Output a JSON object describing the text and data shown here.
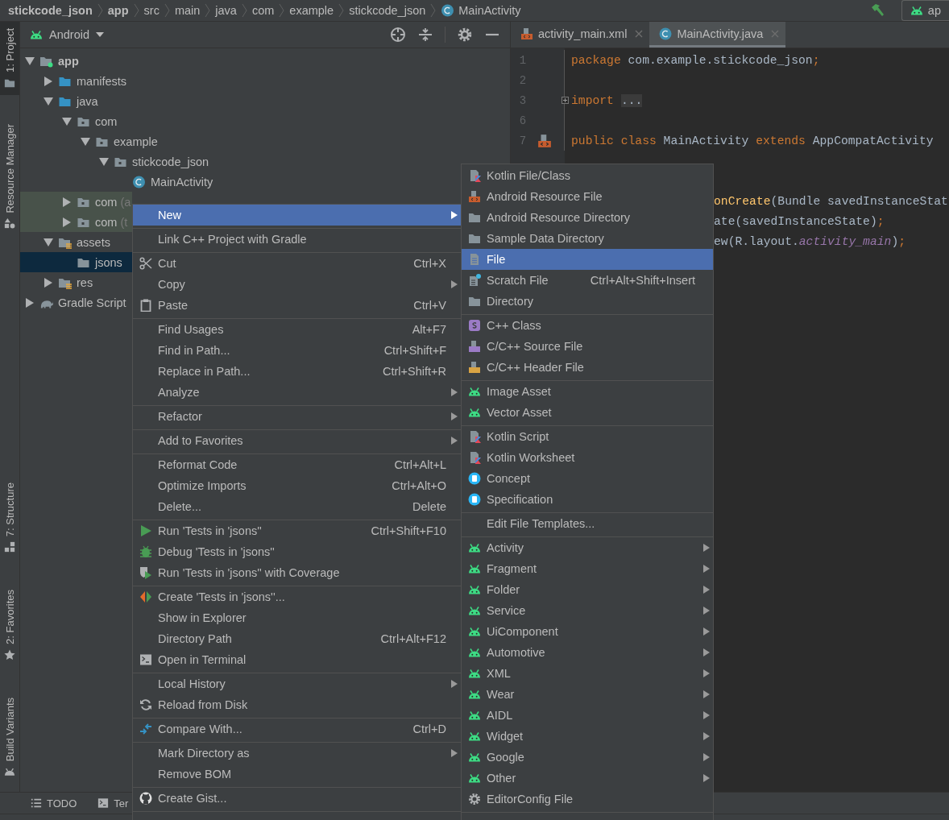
{
  "breadcrumbs": [
    {
      "label": "stickcode_json",
      "bold": true,
      "kind": "path"
    },
    {
      "label": "app",
      "bold": true,
      "kind": "path"
    },
    {
      "label": "src",
      "bold": false,
      "kind": "path"
    },
    {
      "label": "main",
      "bold": false,
      "kind": "path"
    },
    {
      "label": "java",
      "bold": false,
      "kind": "path"
    },
    {
      "label": "com",
      "bold": false,
      "kind": "path"
    },
    {
      "label": "example",
      "bold": false,
      "kind": "path"
    },
    {
      "label": "stickcode_json",
      "bold": false,
      "kind": "path"
    },
    {
      "label": "MainActivity",
      "bold": false,
      "kind": "class"
    }
  ],
  "toolbar": {
    "run_config": "ap"
  },
  "tool_strip": {
    "top": [
      {
        "label": "1: Project",
        "selected": true,
        "kind": "project"
      },
      {
        "label": "Resource Manager",
        "selected": false,
        "kind": "resources"
      }
    ],
    "bottom": [
      {
        "label": "7: Structure",
        "selected": false,
        "kind": "structure"
      },
      {
        "label": "2: Favorites",
        "selected": false,
        "kind": "favorites"
      },
      {
        "label": "Build Variants",
        "selected": false,
        "kind": "build-variants"
      }
    ]
  },
  "project_panel": {
    "view": "Android",
    "tree": [
      {
        "label": "app",
        "kind": "module",
        "bold": true,
        "test": false,
        "selected": false,
        "expanded": true,
        "children": [
          {
            "label": "manifests",
            "kind": "folder-blue",
            "bold": false,
            "test": false,
            "selected": false,
            "expanded": false
          },
          {
            "label": "java",
            "kind": "folder-blue",
            "bold": false,
            "test": false,
            "selected": false,
            "expanded": true,
            "children": [
              {
                "label": "com",
                "kind": "package",
                "bold": false,
                "test": false,
                "selected": false,
                "expanded": true,
                "children": [
                  {
                    "label": "example",
                    "kind": "package",
                    "bold": false,
                    "test": false,
                    "selected": false,
                    "expanded": true,
                    "children": [
                      {
                        "label": "stickcode_json",
                        "kind": "package",
                        "bold": false,
                        "test": false,
                        "selected": false,
                        "expanded": true,
                        "children": [
                          {
                            "label": "MainActivity",
                            "kind": "class",
                            "bold": false,
                            "test": false,
                            "selected": false
                          }
                        ]
                      }
                    ]
                  }
                ]
              },
              {
                "label": "com",
                "suffix": "(a",
                "kind": "package",
                "bold": false,
                "test": true,
                "selected": false,
                "expanded": false
              },
              {
                "label": "com",
                "suffix": "(t",
                "kind": "package",
                "bold": false,
                "test": true,
                "selected": false,
                "expanded": false
              }
            ]
          },
          {
            "label": "assets",
            "kind": "res-folder",
            "bold": false,
            "test": false,
            "selected": false,
            "expanded": true,
            "children": [
              {
                "label": "jsons",
                "kind": "folder",
                "bold": false,
                "test": false,
                "selected": true
              }
            ]
          },
          {
            "label": "res",
            "kind": "res-folder",
            "bold": false,
            "test": false,
            "selected": false,
            "expanded": false
          }
        ]
      },
      {
        "label": "Gradle Script",
        "kind": "gradle",
        "bold": false,
        "test": false,
        "selected": false,
        "expanded": false
      }
    ]
  },
  "editor": {
    "tabs": [
      {
        "label": "activity_main.xml",
        "kind": "xml",
        "selected": false
      },
      {
        "label": "MainActivity.java",
        "kind": "class",
        "selected": true
      }
    ],
    "lines": [
      {
        "number": "1",
        "kind": "code",
        "tokens": [
          {
            "kind": "kw",
            "t": "package"
          },
          {
            "kind": "plain",
            "t": " com.example.stickcode_json"
          },
          {
            "kind": "kw",
            "t": ";"
          }
        ]
      },
      {
        "number": "2",
        "kind": "blank"
      },
      {
        "number": "3",
        "kind": "folded",
        "tokens": [
          {
            "kind": "kw",
            "t": "import"
          },
          {
            "kind": "folded",
            "t": "..."
          }
        ]
      },
      {
        "number": "6",
        "kind": "blank"
      },
      {
        "number": "7",
        "kind": "layout-marker",
        "tokens": [
          {
            "kind": "kw",
            "t": "public class"
          },
          {
            "kind": "plain",
            "t": " MainActivity "
          },
          {
            "kind": "kw",
            "t": "extends"
          },
          {
            "kind": "plain",
            "t": " AppCompatActivity"
          }
        ]
      }
    ],
    "partial_lines": [
      {
        "tokens": [
          {
            "kind": "method",
            "t": "onCreate"
          },
          {
            "kind": "plain",
            "t": "(Bundle savedInstanceStat"
          }
        ]
      },
      {
        "tokens": [
          {
            "kind": "plain",
            "t": "ate(savedInstanceState)"
          },
          {
            "kind": "kw",
            "t": ";"
          }
        ]
      },
      {
        "tokens": [
          {
            "kind": "plain",
            "t": "ew(R.layout."
          },
          {
            "kind": "field",
            "t": "activity_main"
          },
          {
            "kind": "plain",
            "t": ")"
          },
          {
            "kind": "kw",
            "t": ";"
          }
        ]
      }
    ]
  },
  "context_menu": [
    [
      {
        "label": "New",
        "kind": "plain",
        "submenu": true,
        "selected": true
      }
    ],
    [
      {
        "label": "Link C++ Project with Gradle",
        "kind": "plain",
        "submenu": false,
        "selected": false
      }
    ],
    [
      {
        "label": "Cut",
        "kind": "scissors",
        "shortcut": "Ctrl+X",
        "submenu": false,
        "selected": false
      },
      {
        "label": "Copy",
        "kind": "plain",
        "submenu": true,
        "selected": false
      },
      {
        "label": "Paste",
        "kind": "clipboard",
        "shortcut": "Ctrl+V",
        "submenu": false,
        "selected": false
      }
    ],
    [
      {
        "label": "Find Usages",
        "kind": "plain",
        "shortcut": "Alt+F7",
        "submenu": false,
        "selected": false
      },
      {
        "label": "Find in Path...",
        "kind": "plain",
        "shortcut": "Ctrl+Shift+F",
        "submenu": false,
        "selected": false
      },
      {
        "label": "Replace in Path...",
        "kind": "plain",
        "shortcut": "Ctrl+Shift+R",
        "submenu": false,
        "selected": false
      },
      {
        "label": "Analyze",
        "kind": "plain",
        "submenu": true,
        "selected": false
      }
    ],
    [
      {
        "label": "Refactor",
        "kind": "plain",
        "submenu": true,
        "selected": false
      }
    ],
    [
      {
        "label": "Add to Favorites",
        "kind": "plain",
        "submenu": true,
        "selected": false
      }
    ],
    [
      {
        "label": "Reformat Code",
        "kind": "plain",
        "shortcut": "Ctrl+Alt+L",
        "submenu": false,
        "selected": false
      },
      {
        "label": "Optimize Imports",
        "kind": "plain",
        "shortcut": "Ctrl+Alt+O",
        "submenu": false,
        "selected": false
      },
      {
        "label": "Delete...",
        "kind": "plain",
        "shortcut": "Delete",
        "submenu": false,
        "selected": false
      }
    ],
    [
      {
        "label": "Run 'Tests in 'jsons''",
        "kind": "run",
        "shortcut": "Ctrl+Shift+F10",
        "submenu": false,
        "selected": false
      },
      {
        "label": "Debug 'Tests in 'jsons''",
        "kind": "bug",
        "submenu": false,
        "selected": false
      },
      {
        "label": "Run 'Tests in 'jsons'' with Coverage",
        "kind": "coverage",
        "submenu": false,
        "selected": false
      }
    ],
    [
      {
        "label": "Create 'Tests in 'jsons''...",
        "kind": "create-test",
        "submenu": false,
        "selected": false
      },
      {
        "label": "Show in Explorer",
        "kind": "plain",
        "submenu": false,
        "selected": false
      },
      {
        "label": "Directory Path",
        "kind": "plain",
        "shortcut": "Ctrl+Alt+F12",
        "submenu": false,
        "selected": false
      },
      {
        "label": "Open in Terminal",
        "kind": "terminal",
        "submenu": false,
        "selected": false
      }
    ],
    [
      {
        "label": "Local History",
        "kind": "plain",
        "submenu": true,
        "selected": false
      },
      {
        "label": "Reload from Disk",
        "kind": "reload",
        "submenu": false,
        "selected": false
      }
    ],
    [
      {
        "label": "Compare With...",
        "kind": "compare",
        "shortcut": "Ctrl+D",
        "submenu": false,
        "selected": false
      }
    ],
    [
      {
        "label": "Mark Directory as",
        "kind": "plain",
        "submenu": true,
        "selected": false
      },
      {
        "label": "Remove BOM",
        "kind": "plain",
        "submenu": false,
        "selected": false
      }
    ],
    [
      {
        "label": "Create Gist...",
        "kind": "github",
        "submenu": false,
        "selected": false
      }
    ]
  ],
  "new_submenu": [
    [
      {
        "label": "Kotlin File/Class",
        "kind": "kotlin",
        "submenu": false,
        "selected": false
      },
      {
        "label": "Android Resource File",
        "kind": "xml",
        "submenu": false,
        "selected": false
      },
      {
        "label": "Android Resource Directory",
        "kind": "folder",
        "submenu": false,
        "selected": false
      },
      {
        "label": "Sample Data Directory",
        "kind": "folder",
        "submenu": false,
        "selected": false
      },
      {
        "label": "File",
        "kind": "file",
        "submenu": false,
        "selected": true
      },
      {
        "label": "Scratch File",
        "kind": "scratch",
        "shortcut": "Ctrl+Alt+Shift+Insert",
        "submenu": false,
        "selected": false
      },
      {
        "label": "Directory",
        "kind": "folder",
        "submenu": false,
        "selected": false
      }
    ],
    [
      {
        "label": "C++ Class",
        "kind": "cpp-class",
        "submenu": false,
        "selected": false
      },
      {
        "label": "C/C++ Source File",
        "kind": "cpp-source",
        "submenu": false,
        "selected": false
      },
      {
        "label": "C/C++ Header File",
        "kind": "cpp-header",
        "submenu": false,
        "selected": false
      }
    ],
    [
      {
        "label": "Image Asset",
        "kind": "android",
        "submenu": false,
        "selected": false
      },
      {
        "label": "Vector Asset",
        "kind": "android",
        "submenu": false,
        "selected": false
      }
    ],
    [
      {
        "label": "Kotlin Script",
        "kind": "kotlin",
        "submenu": false,
        "selected": false
      },
      {
        "label": "Kotlin Worksheet",
        "kind": "kotlin",
        "submenu": false,
        "selected": false
      },
      {
        "label": "Concept",
        "kind": "concept",
        "submenu": false,
        "selected": false
      },
      {
        "label": "Specification",
        "kind": "concept",
        "submenu": false,
        "selected": false
      }
    ],
    [
      {
        "label": "Edit File Templates...",
        "kind": "plain",
        "submenu": false,
        "selected": false
      }
    ],
    [
      {
        "label": "Activity",
        "kind": "android",
        "submenu": true,
        "selected": false
      },
      {
        "label": "Fragment",
        "kind": "android",
        "submenu": true,
        "selected": false
      },
      {
        "label": "Folder",
        "kind": "android",
        "submenu": true,
        "selected": false
      },
      {
        "label": "Service",
        "kind": "android",
        "submenu": true,
        "selected": false
      },
      {
        "label": "UiComponent",
        "kind": "android",
        "submenu": true,
        "selected": false
      },
      {
        "label": "Automotive",
        "kind": "android",
        "submenu": true,
        "selected": false
      },
      {
        "label": "XML",
        "kind": "android",
        "submenu": true,
        "selected": false
      },
      {
        "label": "Wear",
        "kind": "android",
        "submenu": true,
        "selected": false
      },
      {
        "label": "AIDL",
        "kind": "android",
        "submenu": true,
        "selected": false
      },
      {
        "label": "Widget",
        "kind": "android",
        "submenu": true,
        "selected": false
      },
      {
        "label": "Google",
        "kind": "android",
        "submenu": true,
        "selected": false
      },
      {
        "label": "Other",
        "kind": "android",
        "submenu": true,
        "selected": false
      },
      {
        "label": "EditorConfig File",
        "kind": "gear",
        "submenu": false,
        "selected": false
      }
    ]
  ],
  "bottom_bar": [
    {
      "label": "TODO",
      "kind": "todo"
    },
    {
      "label": "Ter",
      "kind": "terminal"
    }
  ]
}
